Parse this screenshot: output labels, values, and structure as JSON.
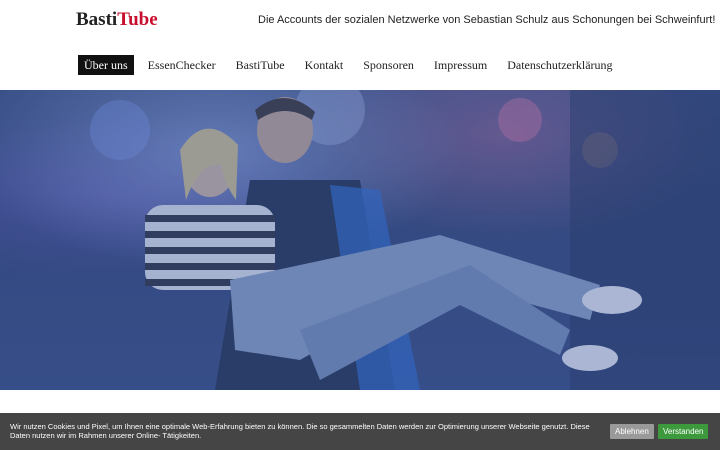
{
  "header": {
    "logo_part1": "Basti",
    "logo_part2": "Tube",
    "tagline": "Die Accounts der sozialen Netzwerke von Sebastian Schulz aus Schonungen bei Schweinfurt!"
  },
  "nav": {
    "items": [
      {
        "label": "Über uns",
        "active": true
      },
      {
        "label": "EssenChecker",
        "active": false
      },
      {
        "label": "BastiTube",
        "active": false
      },
      {
        "label": "Kontakt",
        "active": false
      },
      {
        "label": "Sponsoren",
        "active": false
      },
      {
        "label": "Impressum",
        "active": false
      },
      {
        "label": "Datenschutzerklärung",
        "active": false
      }
    ]
  },
  "cookie": {
    "text": "Wir nutzen Cookies und Pixel, um Ihnen eine optimale Web-Erfahrung bieten zu können. Die so gesammelten Daten werden zur Optimierung unserer Webseite genutzt. Diese Daten nutzen wir im Rahmen unserer Online- Tätigkeiten.",
    "decline_label": "Ablehnen",
    "accept_label": "Verstanden"
  },
  "colors": {
    "logo_accent": "#c8102e",
    "nav_active_bg": "#111111",
    "cookie_bg": "#454545",
    "accept_button": "#3c9a3c",
    "decline_button": "#9a9a9a"
  }
}
